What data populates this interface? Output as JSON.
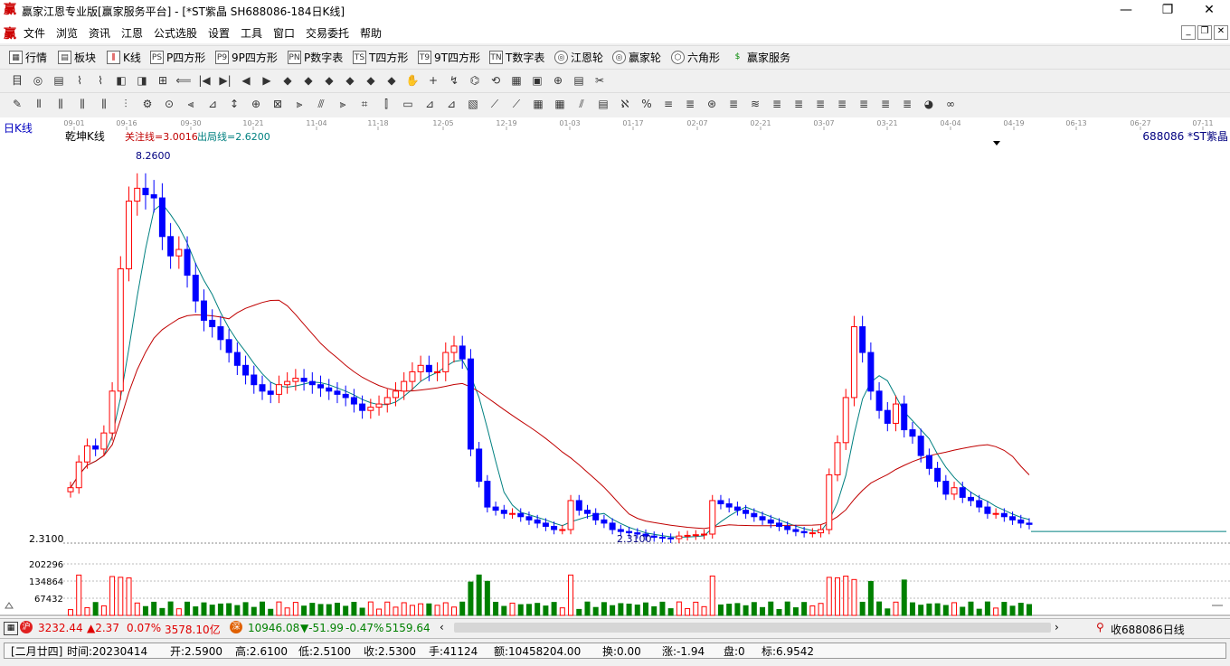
{
  "window": {
    "title": "赢家江恩专业版[赢家服务平台] - [*ST紫晶  SH688086-184日K线]",
    "app_icon": "赢",
    "minimize": "—",
    "maximize": "❐",
    "close": "✕"
  },
  "menu": [
    "文件",
    "浏览",
    "资讯",
    "江恩",
    "公式选股",
    "设置",
    "工具",
    "窗口",
    "交易委托",
    "帮助"
  ],
  "mdi_buttons": [
    "_",
    "❐",
    "✕"
  ],
  "toolbar1": [
    {
      "icon": "grid-icon",
      "label": "行情"
    },
    {
      "icon": "blocks-icon",
      "label": "板块"
    },
    {
      "icon": "candle-icon",
      "label": "K线"
    },
    {
      "icon": "PS",
      "label": "P四方形"
    },
    {
      "icon": "P9",
      "label": "9P四方形"
    },
    {
      "icon": "PN",
      "label": "P数字表"
    },
    {
      "icon": "TS",
      "label": "T四方形"
    },
    {
      "icon": "T9",
      "label": "9T四方形"
    },
    {
      "icon": "TN",
      "label": "T数字表"
    },
    {
      "icon": "wheel-icon",
      "label": "江恩轮"
    },
    {
      "icon": "wheel-icon",
      "label": "赢家轮"
    },
    {
      "icon": "hexagon-icon",
      "label": "六角形"
    },
    {
      "icon": "dollar-icon",
      "label": "赢家服务"
    }
  ],
  "toolbar2_glyphs": [
    "目",
    "◎",
    "▤",
    "⌇",
    "⌇",
    "◧",
    "◨",
    "⊞",
    "⟸",
    "|◀",
    "▶|",
    "◀",
    "▶",
    "◆",
    "◆",
    "◆",
    "◆",
    "◆",
    "◆",
    "✋",
    "+",
    "↯",
    "⌬",
    "⟲",
    "▦",
    "▣",
    "⊕",
    "▤",
    "✂"
  ],
  "toolbar3_glyphs": [
    "✎",
    "⫴",
    "⫼",
    "⫼",
    "⫼",
    "⫶",
    "⚙",
    "⊙",
    "⫷",
    "⊿",
    "↕",
    "⊕",
    "⊠",
    "⫸",
    "⫻",
    "⫸",
    "⌗",
    "⫿",
    "▭",
    "⊿",
    "⊿",
    "▧",
    "⟋",
    "⟋",
    "▦",
    "▦",
    "⫽",
    "▤",
    "ℵ",
    "%",
    "≡",
    "≣",
    "⊛",
    "≣",
    "≋",
    "≣",
    "≣",
    "≣",
    "≣",
    "≣",
    "≣",
    "≣",
    "◕",
    "∞"
  ],
  "chart": {
    "period_label": "日K线",
    "date_ticks": [
      "09-01",
      "09-16",
      "09-30",
      "10-21",
      "11-04",
      "11-18",
      "12-05",
      "12-19",
      "01-03",
      "01-17",
      "02-07",
      "02-21",
      "03-07",
      "03-21",
      "04-04",
      "04-19",
      "06-13",
      "06-27",
      "07-11"
    ],
    "indicator_name": "乾坤K线",
    "watch_line": "关注线=3.0016",
    "exit_line": "出局线=2.6200",
    "stock_label": "688086 *ST紫晶",
    "high_label": "8.2600",
    "low_label": "2.3100",
    "low_marker": "2.3100",
    "volume_ticks": [
      "202296",
      "134864",
      "67432"
    ],
    "colors": {
      "up": "#ff0000",
      "down": "#0000ff",
      "neutral": "#800080",
      "ma_short": "#008080",
      "ma_long": "#c00000",
      "vol_up": "#ff0000",
      "vol_down": "#008000"
    }
  },
  "indices": {
    "sh_value": "3232.44",
    "sh_change": "▲2.37",
    "sh_pct": "0.07%",
    "sh_amount": "3578.10亿",
    "sz_badge": "深",
    "sz_value": "10946.08",
    "sz_change": "▼-51.99",
    "sz_pct": "-0.47%",
    "sz_amount": "5159.64",
    "collect": "收688086日线"
  },
  "status": {
    "lunar": "[二月廿四]",
    "time": "时间:20230414",
    "open": "开:2.5900",
    "high": "高:2.6100",
    "low": "低:2.5100",
    "close": "收:2.5300",
    "hands": "手:41124",
    "amount": "额:10458204.00",
    "turnover": "换:0.00",
    "change": "涨:-1.94",
    "pan": "盘:0",
    "mark": "标:6.9542"
  }
}
